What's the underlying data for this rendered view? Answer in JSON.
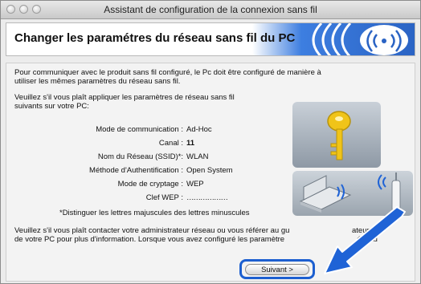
{
  "window": {
    "title": "Assistant de configuration de la connexion sans fil"
  },
  "header": {
    "title": "Changer les paramétres du réseau sans fil du PC"
  },
  "content": {
    "intro": [
      "Pour communiquer avec le produit sans fil configuré, le Pc doit être configuré de manière à",
      "utiliser les mêmes paramètres du réseau sans fil."
    ],
    "apply": [
      "Veuillez s'il vous plaît appliquer les paramètres de réseau sans fil",
      "suivants sur votre PC:"
    ],
    "settings": [
      {
        "label": "Mode de communication :",
        "value": "Ad-Hoc",
        "bold": false
      },
      {
        "label": "Canal :",
        "value": "11",
        "bold": true
      },
      {
        "label": "Nom du Réseau (SSID)*:",
        "value": "WLAN",
        "bold": false
      },
      {
        "label": "Méthode d'Authentification :",
        "value": "Open System",
        "bold": false
      },
      {
        "label": "Mode de cryptage :",
        "value": "WEP",
        "bold": false
      },
      {
        "label": "Clef WEP :",
        "value": "………………",
        "bold": false
      }
    ],
    "note": "*Distinguer les lettres majuscules des lettres minuscules",
    "contact": [
      "Veuillez s'il vous plaît contacter votre administrateur réseau ou vous référer au gu",
      "de votre PC pour plus d'information. Lorsque vous avez configuré les paramètre"
    ],
    "contact_tail": [
      "ateur",
      "éseau"
    ]
  },
  "buttons": {
    "next": "Suivant >"
  },
  "colors": {
    "accent": "#1c5fd0",
    "arrow": "#1f63d6",
    "key": "#f0c419"
  },
  "icons": [
    "key-icon",
    "laptop-icon",
    "wireless-waves-icon",
    "access-point-icon",
    "arrow-pointer-icon"
  ]
}
